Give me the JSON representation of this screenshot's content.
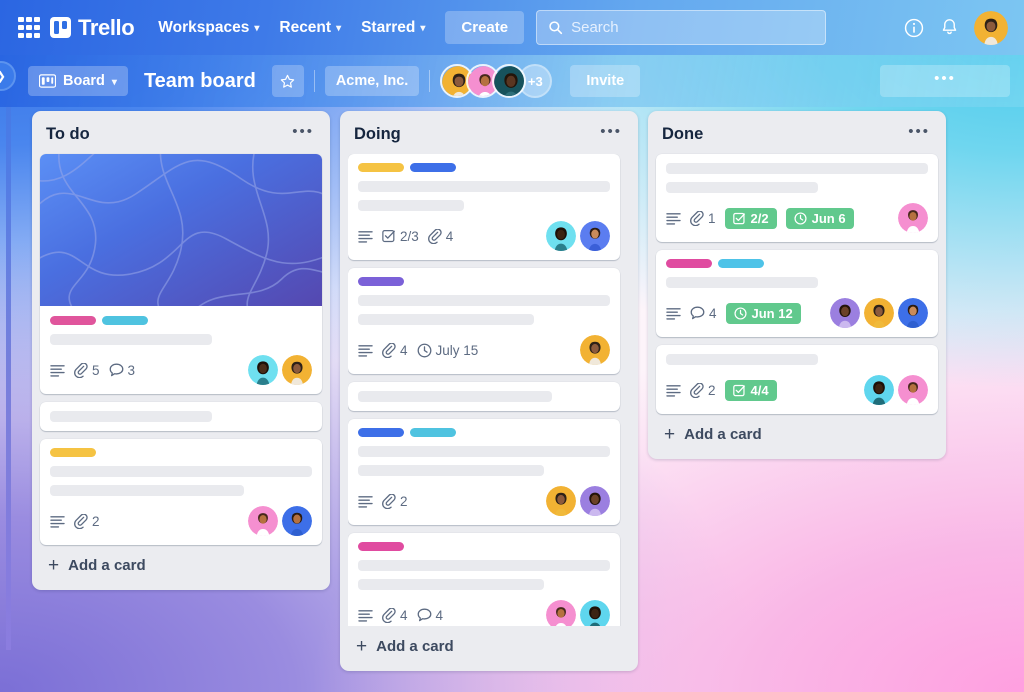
{
  "topnav": {
    "apps_icon": "grid-apps-icon",
    "logo_text": "Trello",
    "menus": [
      {
        "label": "Workspaces",
        "caret": "⌄"
      },
      {
        "label": "Recent",
        "caret": "⌄"
      },
      {
        "label": "Starred",
        "caret": "⌄"
      }
    ],
    "create_label": "Create",
    "search_placeholder": "Search",
    "search_value": "",
    "info_icon": "info-circle-icon",
    "bell_icon": "notification-bell-icon",
    "account_avatar": "user-avatar"
  },
  "boardbar": {
    "sidebar_toggle_icon": "chevron-right-icon",
    "view_label": "Board",
    "view_icon": "board-view-icon",
    "view_caret": "⌄",
    "title": "Team board",
    "star_icon": "star-outline-icon",
    "workspace": "Acme, Inc.",
    "extra_members": "+3",
    "invite_label": "Invite",
    "menu_label": "•••"
  },
  "colors": {
    "label_pink": "#e0559c",
    "label_cyan": "#4fc3e0",
    "label_yellow": "#f5c343",
    "label_blue": "#3d6fe8",
    "label_purple": "#7b61d8",
    "label_magenta": "#e04ba0",
    "label_sky": "#4ec3e8",
    "badge_green": "#61c98d",
    "nav_blue": "#2b66e2",
    "list_bg": "#ebecf0"
  },
  "lists": [
    {
      "title": "To do",
      "menu": "•••",
      "add_card_label": "Add a card",
      "cards": [
        {
          "cover": true,
          "labels": [
            "#e0559c",
            "#4fc3e0"
          ],
          "placeholders": [
            62
          ],
          "badges": [
            {
              "type": "description",
              "icon": "description-icon",
              "text": ""
            },
            {
              "type": "attachment",
              "icon": "attachment-icon",
              "text": "5"
            },
            {
              "type": "comment",
              "icon": "comment-icon",
              "text": "3"
            }
          ],
          "avatars": [
            "avatar-cyan",
            "avatar-yellow"
          ]
        },
        {
          "cover": false,
          "labels": [],
          "placeholders": [
            62
          ],
          "badges": [],
          "avatars": []
        },
        {
          "cover": false,
          "labels": [
            "#f5c343"
          ],
          "placeholders": [
            100,
            74
          ],
          "badges": [
            {
              "type": "description",
              "icon": "description-icon",
              "text": ""
            },
            {
              "type": "attachment",
              "icon": "attachment-icon",
              "text": "2"
            }
          ],
          "avatars": [
            "avatar-pink",
            "avatar-blue"
          ]
        }
      ]
    },
    {
      "title": "Doing",
      "menu": "•••",
      "add_card_label": "Add a card",
      "scrollable": true,
      "cards": [
        {
          "cover": false,
          "labels": [
            "#f5c343",
            "#3d6fe8"
          ],
          "placeholders": [
            100,
            42
          ],
          "badges": [
            {
              "type": "description",
              "icon": "description-icon",
              "text": ""
            },
            {
              "type": "checklist",
              "icon": "checklist-icon",
              "text": "2/3"
            },
            {
              "type": "attachment",
              "icon": "attachment-icon",
              "text": "4"
            }
          ],
          "avatars": [
            "avatar-cyan",
            "avatar-blue"
          ]
        },
        {
          "cover": false,
          "labels": [
            "#7b61d8"
          ],
          "placeholders": [
            100,
            70
          ],
          "badges": [
            {
              "type": "description",
              "icon": "description-icon",
              "text": ""
            },
            {
              "type": "attachment",
              "icon": "attachment-icon",
              "text": "4"
            },
            {
              "type": "due",
              "icon": "clock-icon",
              "text": "July 15"
            }
          ],
          "avatars": [
            "avatar-yellow"
          ]
        },
        {
          "cover": false,
          "labels": [],
          "placeholders": [
            77
          ],
          "badges": [],
          "avatars": []
        },
        {
          "cover": false,
          "labels": [
            "#3d6fe8",
            "#4fc3e0"
          ],
          "placeholders": [
            100,
            74
          ],
          "badges": [
            {
              "type": "description",
              "icon": "description-icon",
              "text": ""
            },
            {
              "type": "attachment",
              "icon": "attachment-icon",
              "text": "2"
            }
          ],
          "avatars": [
            "avatar-yellow",
            "avatar-purple"
          ]
        },
        {
          "cover": false,
          "labels": [
            "#e04ba0"
          ],
          "placeholders": [
            100,
            74
          ],
          "badges": [
            {
              "type": "description",
              "icon": "description-icon",
              "text": ""
            },
            {
              "type": "attachment",
              "icon": "attachment-icon",
              "text": "4"
            },
            {
              "type": "comment",
              "icon": "comment-icon",
              "text": "4"
            }
          ],
          "avatars": [
            "avatar-pink",
            "avatar-cyan"
          ]
        }
      ]
    },
    {
      "title": "Done",
      "menu": "•••",
      "add_card_label": "Add a card",
      "cards": [
        {
          "cover": false,
          "labels": [],
          "placeholders": [
            100,
            58
          ],
          "badges": [
            {
              "type": "description",
              "icon": "description-icon",
              "text": ""
            },
            {
              "type": "attachment",
              "icon": "attachment-icon",
              "text": "1"
            },
            {
              "type": "checklist-pill",
              "icon": "checklist-icon",
              "text": "2/2"
            },
            {
              "type": "due-pill",
              "icon": "clock-icon",
              "text": "Jun 6"
            }
          ],
          "avatars": [
            "avatar-pink"
          ]
        },
        {
          "cover": false,
          "labels": [
            "#e04ba0",
            "#4ec3e8"
          ],
          "placeholders": [
            58
          ],
          "badges": [
            {
              "type": "description",
              "icon": "description-icon",
              "text": ""
            },
            {
              "type": "comment",
              "icon": "comment-icon",
              "text": "4"
            },
            {
              "type": "due-pill",
              "icon": "clock-icon",
              "text": "Jun 12"
            }
          ],
          "avatars": [
            "avatar-purple",
            "avatar-yellow",
            "avatar-blue"
          ]
        },
        {
          "cover": false,
          "labels": [],
          "placeholders": [
            58
          ],
          "badges": [
            {
              "type": "description",
              "icon": "description-icon",
              "text": ""
            },
            {
              "type": "attachment",
              "icon": "attachment-icon",
              "text": "2"
            },
            {
              "type": "checklist-pill",
              "icon": "checklist-icon",
              "text": "4/4"
            }
          ],
          "avatars": [
            "avatar-cyan",
            "avatar-pink"
          ]
        }
      ]
    }
  ]
}
